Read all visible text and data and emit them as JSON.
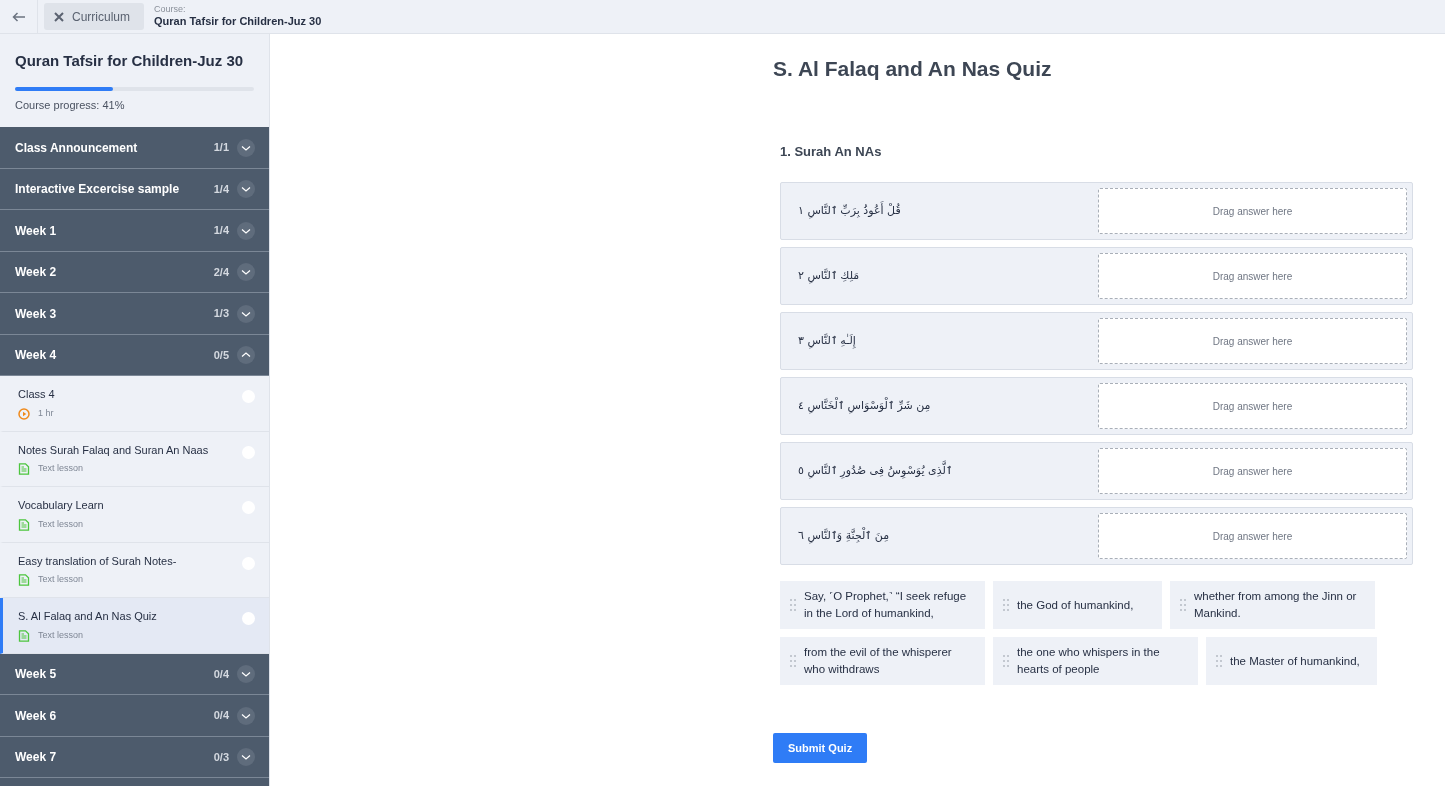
{
  "topbar": {
    "close_label": "Curriculum",
    "course_caption": "Course:",
    "course_name": "Quran Tafsir for Children-Juz 30"
  },
  "sidebar": {
    "title": "Quran Tafsir for Children-Juz 30",
    "progress": {
      "level": 0.41,
      "label": "Course progress: 41%"
    },
    "sections": [
      {
        "title": "Class Announcement",
        "count": "1/1",
        "expanded": false
      },
      {
        "title": "Interactive Excercise sample",
        "count": "1/4",
        "expanded": false
      },
      {
        "title": "Week 1",
        "count": "1/4",
        "expanded": false
      },
      {
        "title": "Week 2",
        "count": "2/4",
        "expanded": false
      },
      {
        "title": "Week 3",
        "count": "1/3",
        "expanded": false
      },
      {
        "title": "Week 4",
        "count": "0/5",
        "expanded": true,
        "items": [
          {
            "title": "Class 4",
            "kind": "video",
            "meta": "1 hr",
            "selected": false
          },
          {
            "title": "Notes Surah Falaq and Suran An Naas",
            "kind": "text",
            "meta": "Text lesson",
            "selected": false
          },
          {
            "title": "Vocabulary Learn",
            "kind": "text",
            "meta": "Text lesson",
            "selected": false
          },
          {
            "title": "Easy translation of Surah Notes-",
            "kind": "text",
            "meta": "Text lesson",
            "selected": false
          },
          {
            "title": "S. Al Falaq and An Nas Quiz",
            "kind": "text",
            "meta": "Text lesson",
            "selected": true
          }
        ]
      },
      {
        "title": "Week 5",
        "count": "0/4",
        "expanded": false
      },
      {
        "title": "Week 6",
        "count": "0/4",
        "expanded": false
      },
      {
        "title": "Week 7",
        "count": "0/3",
        "expanded": false
      }
    ]
  },
  "quiz": {
    "title": "S. Al Falaq and An Nas Quiz",
    "question": "1. Surah An NAs",
    "rows": [
      {
        "text": "قُلْ أَعُوذُ بِرَبِّ ٱلنَّاسِ ١",
        "placeholder": "Drag answer here"
      },
      {
        "text": "مَلِكِ ٱلنَّاسِ ٢",
        "placeholder": "Drag answer here"
      },
      {
        "text": "إِلَـٰهِ ٱلنَّاسِ ٣",
        "placeholder": "Drag answer here"
      },
      {
        "text": "مِن شَرِّ ٱلْوَسْوَاسِ ٱلْخَنَّاسِ ٤",
        "placeholder": "Drag answer here"
      },
      {
        "text": "ٱلَّذِى يُوَسْوِسُ فِى صُدُورِ ٱلنَّاسِ ٥",
        "placeholder": "Drag answer here"
      },
      {
        "text": "مِنَ ٱلْجِنَّةِ وَٱلنَّاسِ ٦",
        "placeholder": "Drag answer here"
      }
    ],
    "answers": [
      {
        "text": "Say, ˹O Prophet,˺ “I seek refuge in the Lord of humankind,"
      },
      {
        "text": "the God of humankind,"
      },
      {
        "text": "whether from among the Jinn or Mankind."
      },
      {
        "text": "from the evil of the whisperer who withdraws"
      },
      {
        "text": "the one who whispers in the hearts of people"
      },
      {
        "text": "the Master of humankind,"
      }
    ],
    "submit": "Submit Quiz"
  }
}
